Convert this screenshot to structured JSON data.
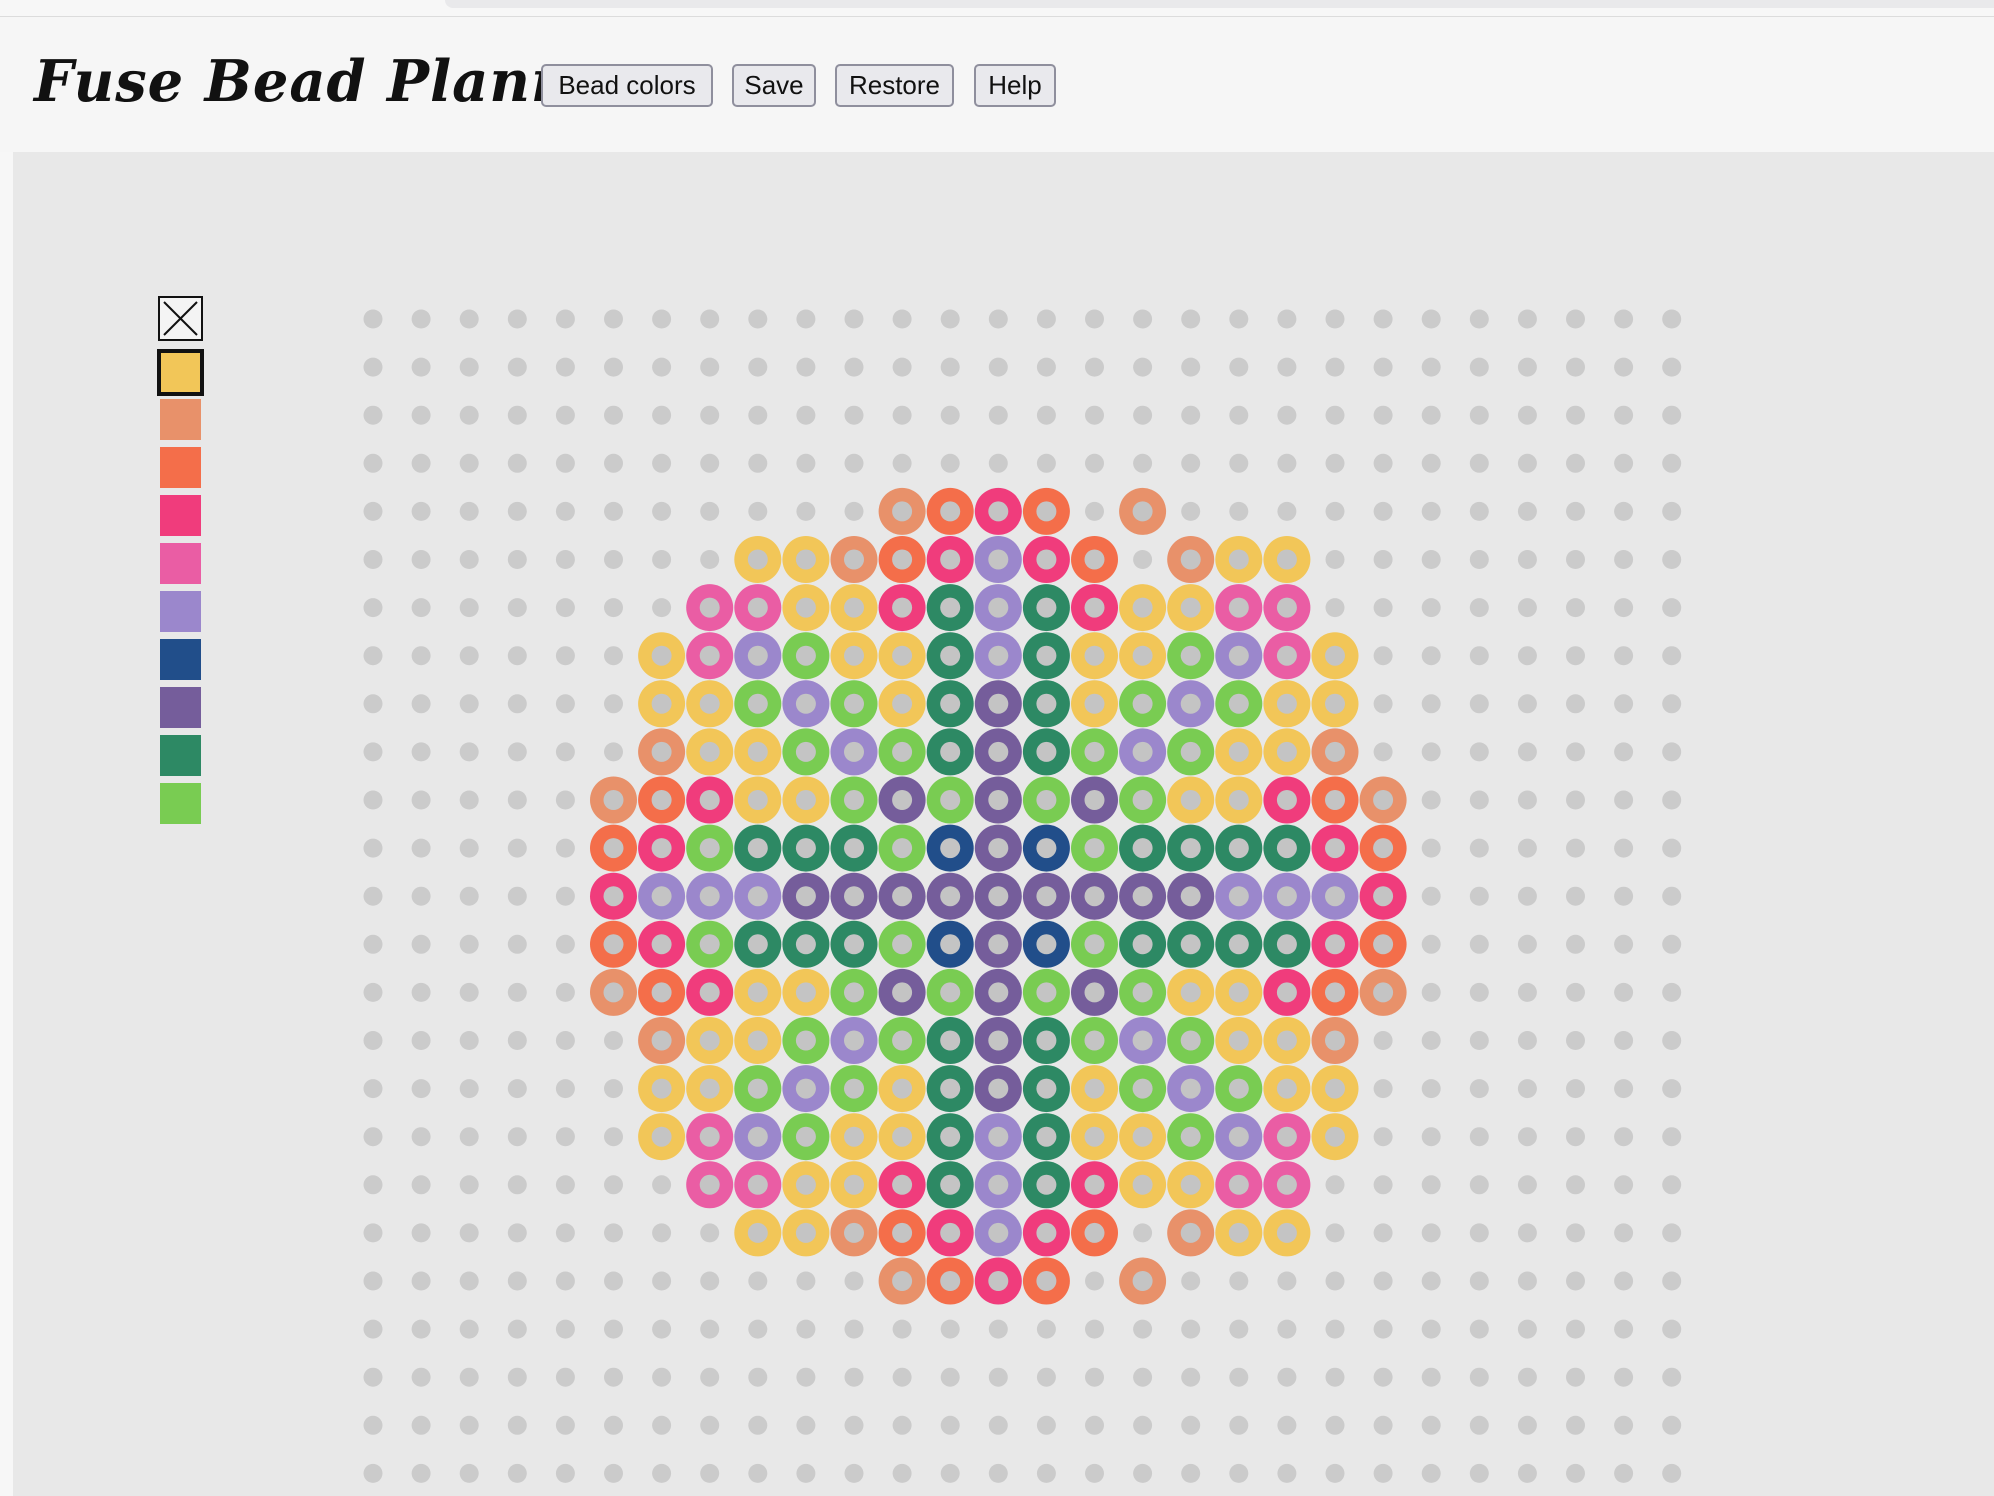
{
  "app": {
    "title": "Fuse Bead Planner"
  },
  "toolbar": {
    "buttons": [
      {
        "id": "bead-colors",
        "label": "Bead colors"
      },
      {
        "id": "save",
        "label": "Save"
      },
      {
        "id": "restore",
        "label": "Restore"
      },
      {
        "id": "help",
        "label": "Help"
      }
    ]
  },
  "palette": {
    "eraser_icon": "close-x-icon",
    "selected_index": 0,
    "colors": [
      "#f2c658",
      "#e8916a",
      "#f46e4a",
      "#f03c7c",
      "#ea5da4",
      "#9b87cc",
      "#214e8a",
      "#755d9b",
      "#2d8964",
      "#79cc52"
    ]
  },
  "board": {
    "rows": 25,
    "cols": 28,
    "empty_peg_color": "#cbcbcb",
    "bead_hole_color": "#c4c4c4",
    "legend": {
      "Y": "#f2c658",
      "P": "#e8916a",
      "O": "#f46e4a",
      "R": "#f03c7c",
      "K": "#ea5da4",
      "L": "#9b87cc",
      "N": "#214e8a",
      "V": "#755d9b",
      "T": "#2d8964",
      "G": "#79cc52"
    },
    "pattern": [
      "............................",
      "............................",
      "............................",
      "............................",
      "...........PORO P...........",
      "........YYPORLRO PYY........",
      ".......KKYYRTLTRYYKK........",
      "......YKLGYYTLTYYGLKY.......",
      "......YYGLGYTVTYGLGYY.......",
      "......PYYGLGTVTGLGYYP.......",
      ".....PORYYGVGVGVGYYROP......",
      ".....ORGTTTGNVNGTTTTRO......",
      ".....RLLLVVVVVVVVVLLLR......",
      ".....ORGTTTGNVNGTTTTRO......",
      ".....PORYYGVGVGVGYYROP......",
      "......PYYGLGTVTGLGYYP.......",
      "......YYGLGYTVTYGLGYY.......",
      "......YKLGYYTLTYYGLKY.......",
      ".......KKYYRTLTRYYKK........",
      "........YYPORLRO PYY........",
      "...........PORO P...........",
      "............................",
      "............................",
      "............................",
      "............................"
    ]
  }
}
